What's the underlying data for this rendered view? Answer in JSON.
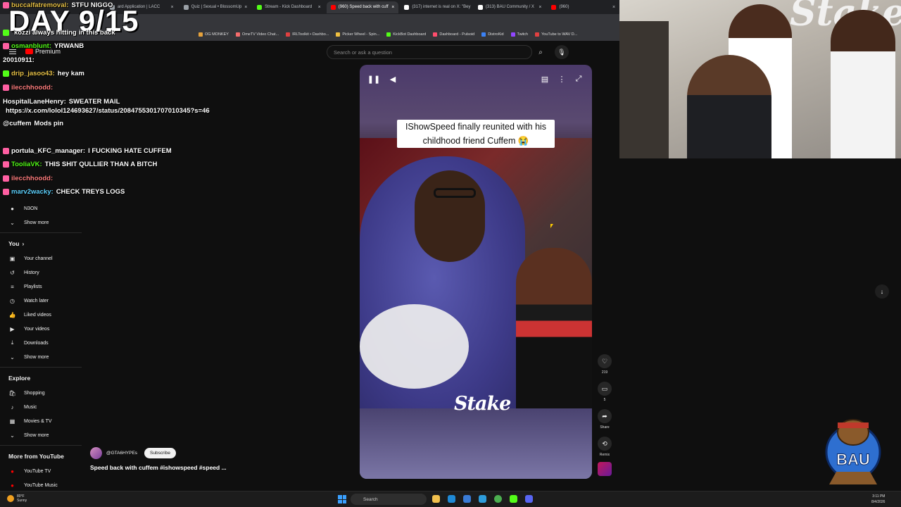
{
  "overlay": {
    "day_label": "DAY 9/15"
  },
  "browser": {
    "tabs": [
      {
        "label": "ard Application | LACC",
        "color": "#9aa0a6"
      },
      {
        "label": "Quiz | Sexual • BlossomUp",
        "color": "#9aa0a6"
      },
      {
        "label": "Stream - Kick Dashboard",
        "color": "#53fc18"
      },
      {
        "label": "(960) Speed back with cuff",
        "color": "#ff0000",
        "active": true
      },
      {
        "label": "(317) internet is real on X: \"Bey",
        "color": "#ffffff"
      },
      {
        "label": "(313) BAU Community / X",
        "color": "#ffffff"
      },
      {
        "label": "(960)",
        "color": "#ff0000"
      }
    ],
    "bookmarks": [
      {
        "label": "OG MONKEY",
        "color": "#e6a23c"
      },
      {
        "label": "OmeTV Video Chat...",
        "color": "#f56c6c"
      },
      {
        "label": "IRLToolkit • Dashbo...",
        "color": "#e04040"
      },
      {
        "label": "Picker Wheel - Spin...",
        "color": "#f0c040"
      },
      {
        "label": "KickBot Dashboard",
        "color": "#53fc18"
      },
      {
        "label": "Dashboard - Pulsoid",
        "color": "#ff4d6d"
      },
      {
        "label": "DistroKid",
        "color": "#3b82f6"
      },
      {
        "label": "Twitch",
        "color": "#9146ff"
      },
      {
        "label": "YouTube to WAV D...",
        "color": "#e04040"
      }
    ]
  },
  "youtube": {
    "logo_text": "Premium",
    "search_placeholder": "Search or ask a question",
    "sidebar": {
      "sub_items": [
        {
          "label": "N3ON",
          "icon": "avatar-icon"
        },
        {
          "label": "Show more",
          "icon": "chevron-down-icon"
        }
      ],
      "you_heading": "You",
      "you_items": [
        {
          "label": "Your channel",
          "icon": "channel-icon"
        },
        {
          "label": "History",
          "icon": "history-icon"
        },
        {
          "label": "Playlists",
          "icon": "playlists-icon"
        },
        {
          "label": "Watch later",
          "icon": "clock-icon"
        },
        {
          "label": "Liked videos",
          "icon": "thumbs-up-icon"
        },
        {
          "label": "Your videos",
          "icon": "video-icon"
        },
        {
          "label": "Downloads",
          "icon": "download-icon"
        },
        {
          "label": "Show more",
          "icon": "chevron-down-icon"
        }
      ],
      "explore_heading": "Explore",
      "explore_items": [
        {
          "label": "Shopping",
          "icon": "bag-icon"
        },
        {
          "label": "Music",
          "icon": "music-icon"
        },
        {
          "label": "Movies & TV",
          "icon": "film-icon"
        },
        {
          "label": "Show more",
          "icon": "chevron-down-icon"
        }
      ],
      "more_heading": "More from YouTube",
      "more_items": [
        {
          "label": "YouTube TV",
          "color": "#ff0000"
        },
        {
          "label": "YouTube Music",
          "color": "#ff0000"
        }
      ]
    },
    "short": {
      "caption": "IShowSpeed finally reunited with his childhood friend Cuffem 😭",
      "watermark": "Stake",
      "actions": [
        {
          "name": "like",
          "icon": "heart-icon",
          "count": "219"
        },
        {
          "name": "comment",
          "icon": "comment-icon",
          "count": "5"
        },
        {
          "name": "share",
          "icon": "share-icon",
          "count": "Share"
        },
        {
          "name": "remix",
          "icon": "remix-icon",
          "count": "Remix"
        }
      ],
      "channel": "@GTA6HYPEs",
      "subscribe_label": "Subscribe",
      "title": "Speed back with cuffem #ishowspeed #speed ..."
    }
  },
  "chat": [
    {
      "user": "buccalfatremoval:",
      "text": "STFU NIGGO",
      "user_color": "#e9c349",
      "badge": "#ff5fa2"
    },
    {
      "user": "",
      "text": "kozzi always hitting in this back",
      "user_color": "#ffffff",
      "badge": "#53fc18"
    },
    {
      "user": "osmanblunt:",
      "text": "YRWANB",
      "user_color": "#53fc18",
      "badge": "#ff5fa2"
    },
    {
      "user": "20010911:",
      "text": "",
      "user_color": "#ffffff",
      "badge": ""
    },
    {
      "user": "drip_jasoo43:",
      "text": "hey kam",
      "user_color": "#e9c349",
      "badge": "#53fc18"
    },
    {
      "user": "ilecchhoodd:",
      "text": "",
      "user_color": "#ff7f7f",
      "badge": "#ff5fa2"
    },
    {
      "user": "HospitalLaneHenry:",
      "text": "SWEATER MAIL",
      "user_color": "#ffffff",
      "badge": ""
    },
    {
      "user": "",
      "text": "https://x.com/lolol124693627/status/2084755301707010345?s=46",
      "user_color": "#ffffff",
      "badge": ""
    },
    {
      "user": "@cuffem",
      "text": "Mods pin",
      "user_color": "#ffffff",
      "badge": ""
    },
    {
      "user": "portula_KFC_manager:",
      "text": "I FUCKING HATE CUFFEM",
      "user_color": "#ffffff",
      "badge": "#ff5fa2"
    },
    {
      "user": "TooliaVK:",
      "text": "THIS SHIT QULLIER THAN A BITCH",
      "user_color": "#53fc18",
      "badge": "#ff5fa2"
    },
    {
      "user": "ilecchhoodd:",
      "text": "",
      "user_color": "#ff7f7f",
      "badge": "#ff5fa2"
    },
    {
      "user": "marv2wacky:",
      "text": "CHECK TREYS LOGS",
      "user_color": "#5fd3ff",
      "badge": "#ff5fa2"
    }
  ],
  "webcam": {
    "background_text": "Stake"
  },
  "bau_logo": {
    "text": "BAU"
  },
  "taskbar": {
    "weather_temp": "80°F",
    "weather_desc": "Sunny",
    "search_label": "Search",
    "time": "3:11 PM",
    "date": "8/4/2026",
    "icons": [
      "file-explorer-icon",
      "edge-icon",
      "store-icon",
      "mail-icon",
      "chrome-icon",
      "kick-icon",
      "discord-icon"
    ]
  }
}
